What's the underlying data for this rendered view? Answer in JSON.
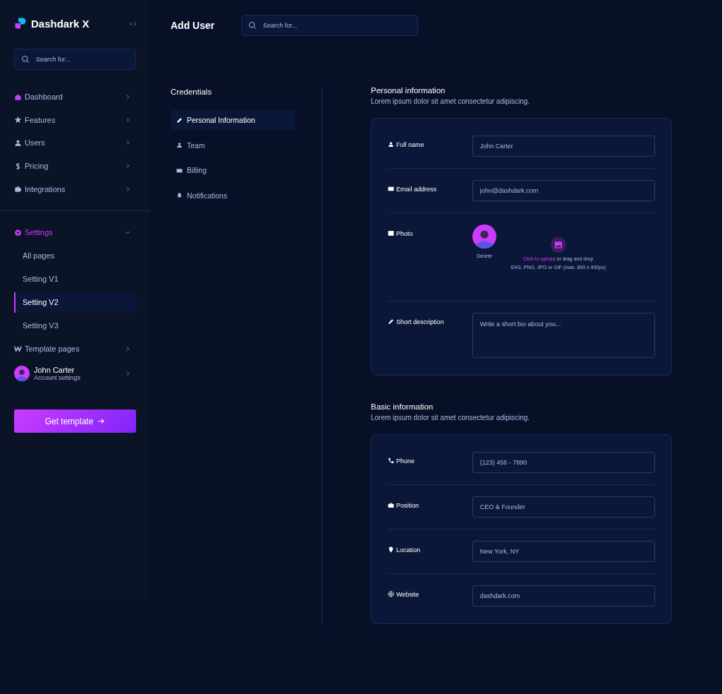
{
  "sidebar": {
    "brand": "Dashdark X",
    "collapse_glyph": "‹ ›",
    "search": {
      "placeholder": "Search for..."
    },
    "nav": [
      {
        "label": "Dashboard",
        "selected": false,
        "expanded": false
      },
      {
        "label": "Features",
        "selected": false,
        "expanded": false
      },
      {
        "label": "Users",
        "selected": false,
        "expanded": false
      },
      {
        "label": "Pricing",
        "selected": false,
        "expanded": false
      },
      {
        "label": "Integrations",
        "selected": false,
        "expanded": false
      }
    ],
    "settings": {
      "label": "Settings",
      "selected": true,
      "expanded": true,
      "children": [
        {
          "label": "All pages",
          "selected": false
        },
        {
          "label": "Setting V1",
          "selected": false
        },
        {
          "label": "Setting V2",
          "selected": true
        },
        {
          "label": "Setting V3",
          "selected": false
        }
      ]
    },
    "template": {
      "label": "Template pages",
      "selected": false,
      "expanded": false
    },
    "user": {
      "name": "John Carter",
      "subtitle": "Account settings"
    },
    "cta": "Get template"
  },
  "header": {
    "title": "Add User",
    "search": {
      "placeholder": "Search for..."
    }
  },
  "credentials": {
    "title": "Credentials",
    "items": [
      {
        "label": "Personal Information",
        "selected": true
      },
      {
        "label": "Team",
        "selected": false
      },
      {
        "label": "Billing",
        "selected": false
      },
      {
        "label": "Notifications",
        "selected": false
      }
    ]
  },
  "sections": [
    {
      "title": "Personal information",
      "subtitle": "Lorem ipsum dolor sit amet consectetur adipiscing.",
      "fields": [
        {
          "kind": "input",
          "label": "Full name",
          "value": "John Carter"
        },
        {
          "kind": "input",
          "label": "Email address",
          "value": "john@dashdark.com"
        },
        {
          "kind": "photo",
          "label": "Photo",
          "delete": "Delete",
          "upload_link": "Click to upload",
          "upload_text": "or drag and drop",
          "upload_hint": "SVG, PNG, JPG or GIF (max. 800 x 400px)"
        },
        {
          "kind": "textarea",
          "label": "Short description",
          "placeholder": "Write a short bio about you..."
        }
      ]
    },
    {
      "title": "Basic information",
      "subtitle": "Lorem ipsum dolor sit amet consectetur adipiscing.",
      "fields": [
        {
          "kind": "input",
          "label": "Phone",
          "value": "(123) 456 - 7890"
        },
        {
          "kind": "input",
          "label": "Position",
          "value": "CEO & Founder"
        },
        {
          "kind": "input",
          "label": "Location",
          "value": "New York, NY"
        },
        {
          "kind": "input",
          "label": "Website",
          "value": "dashdark.com"
        }
      ]
    }
  ]
}
